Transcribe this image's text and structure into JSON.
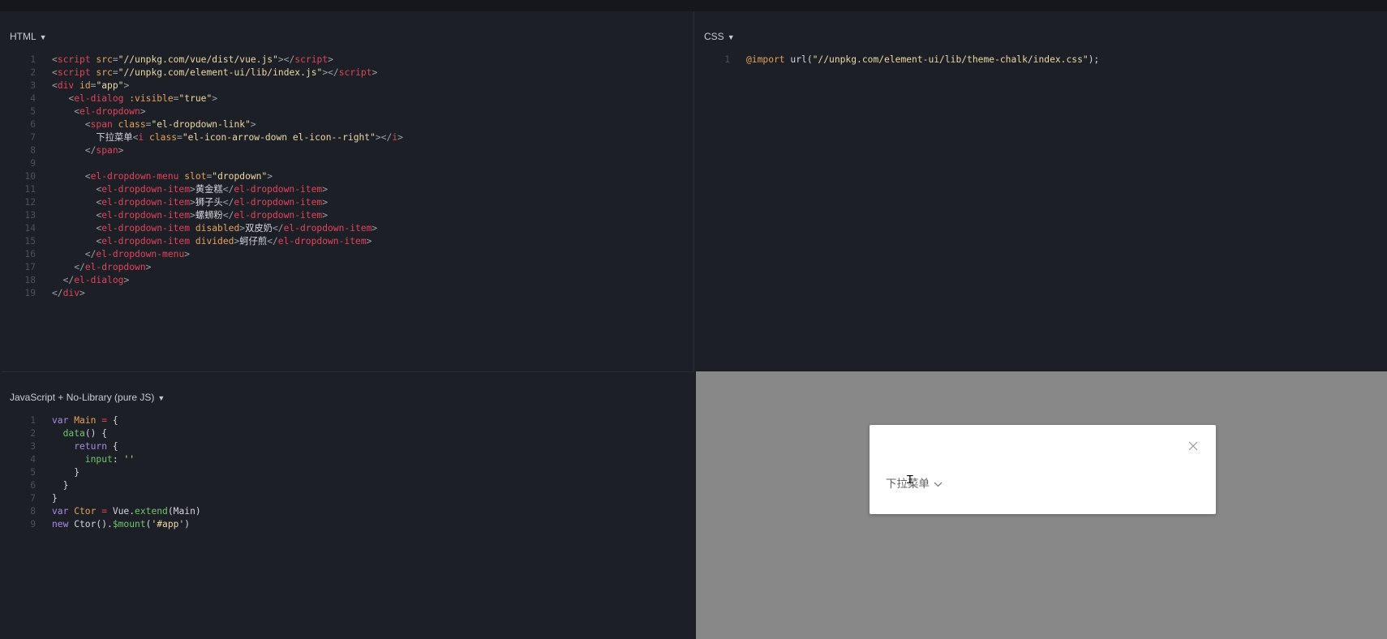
{
  "panels": {
    "html": {
      "title": "HTML"
    },
    "css": {
      "title": "CSS"
    },
    "js": {
      "title": "JavaScript + No-Library (pure JS)"
    }
  },
  "html_code": [
    [
      [
        "t-p",
        "<"
      ],
      [
        "t-tag",
        "script"
      ],
      [
        "t-attr",
        " src"
      ],
      [
        "t-p",
        "="
      ],
      [
        "t-str",
        "\"//unpkg.com/vue/dist/vue.js\""
      ],
      [
        "t-p",
        "></"
      ],
      [
        "t-tag",
        "script"
      ],
      [
        "t-p",
        ">"
      ]
    ],
    [
      [
        "t-p",
        "<"
      ],
      [
        "t-tag",
        "script"
      ],
      [
        "t-attr",
        " src"
      ],
      [
        "t-p",
        "="
      ],
      [
        "t-str",
        "\"//unpkg.com/element-ui/lib/index.js\""
      ],
      [
        "t-p",
        "></"
      ],
      [
        "t-tag",
        "script"
      ],
      [
        "t-p",
        ">"
      ]
    ],
    [
      [
        "t-p",
        "<"
      ],
      [
        "t-tag",
        "div"
      ],
      [
        "t-attr",
        " id"
      ],
      [
        "t-p",
        "="
      ],
      [
        "t-str",
        "\"app\""
      ],
      [
        "t-p",
        ">"
      ]
    ],
    [
      [
        "t-p",
        "   <"
      ],
      [
        "t-tag",
        "el-dialog"
      ],
      [
        "t-attr",
        " :visible"
      ],
      [
        "t-p",
        "="
      ],
      [
        "t-str",
        "\"true\""
      ],
      [
        "t-p",
        ">"
      ]
    ],
    [
      [
        "t-p",
        "    <"
      ],
      [
        "t-tag",
        "el-dropdown"
      ],
      [
        "t-p",
        ">"
      ]
    ],
    [
      [
        "t-p",
        "      <"
      ],
      [
        "t-tag",
        "span"
      ],
      [
        "t-attr",
        " class"
      ],
      [
        "t-p",
        "="
      ],
      [
        "t-str",
        "\"el-dropdown-link\""
      ],
      [
        "t-p",
        ">"
      ]
    ],
    [
      [
        "t-txt",
        "        下拉菜单"
      ],
      [
        "t-p",
        "<"
      ],
      [
        "t-tag",
        "i"
      ],
      [
        "t-attr",
        " class"
      ],
      [
        "t-p",
        "="
      ],
      [
        "t-str",
        "\"el-icon-arrow-down el-icon--right\""
      ],
      [
        "t-p",
        "></"
      ],
      [
        "t-tag",
        "i"
      ],
      [
        "t-p",
        ">"
      ]
    ],
    [
      [
        "t-p",
        "      </"
      ],
      [
        "t-tag",
        "span"
      ],
      [
        "t-p",
        ">"
      ]
    ],
    [],
    [
      [
        "t-p",
        "      <"
      ],
      [
        "t-tag",
        "el-dropdown-menu"
      ],
      [
        "t-attr",
        " slot"
      ],
      [
        "t-p",
        "="
      ],
      [
        "t-str",
        "\"dropdown\""
      ],
      [
        "t-p",
        ">"
      ]
    ],
    [
      [
        "t-p",
        "        <"
      ],
      [
        "t-tag",
        "el-dropdown-item"
      ],
      [
        "t-p",
        ">"
      ],
      [
        "t-txt",
        "黄金糕"
      ],
      [
        "t-p",
        "</"
      ],
      [
        "t-tag",
        "el-dropdown-item"
      ],
      [
        "t-p",
        ">"
      ]
    ],
    [
      [
        "t-p",
        "        <"
      ],
      [
        "t-tag",
        "el-dropdown-item"
      ],
      [
        "t-p",
        ">"
      ],
      [
        "t-txt",
        "狮子头"
      ],
      [
        "t-p",
        "</"
      ],
      [
        "t-tag",
        "el-dropdown-item"
      ],
      [
        "t-p",
        ">"
      ]
    ],
    [
      [
        "t-p",
        "        <"
      ],
      [
        "t-tag",
        "el-dropdown-item"
      ],
      [
        "t-p",
        ">"
      ],
      [
        "t-txt",
        "螺蛳粉"
      ],
      [
        "t-p",
        "</"
      ],
      [
        "t-tag",
        "el-dropdown-item"
      ],
      [
        "t-p",
        ">"
      ]
    ],
    [
      [
        "t-p",
        "        <"
      ],
      [
        "t-tag",
        "el-dropdown-item"
      ],
      [
        "t-attr",
        " disabled"
      ],
      [
        "t-p",
        ">"
      ],
      [
        "t-txt",
        "双皮奶"
      ],
      [
        "t-p",
        "</"
      ],
      [
        "t-tag",
        "el-dropdown-item"
      ],
      [
        "t-p",
        ">"
      ]
    ],
    [
      [
        "t-p",
        "        <"
      ],
      [
        "t-tag",
        "el-dropdown-item"
      ],
      [
        "t-attr",
        " divided"
      ],
      [
        "t-p",
        ">"
      ],
      [
        "t-txt",
        "蚵仔煎"
      ],
      [
        "t-p",
        "</"
      ],
      [
        "t-tag",
        "el-dropdown-item"
      ],
      [
        "t-p",
        ">"
      ]
    ],
    [
      [
        "t-p",
        "      </"
      ],
      [
        "t-tag",
        "el-dropdown-menu"
      ],
      [
        "t-p",
        ">"
      ]
    ],
    [
      [
        "t-p",
        "    </"
      ],
      [
        "t-tag",
        "el-dropdown"
      ],
      [
        "t-p",
        ">"
      ]
    ],
    [
      [
        "t-p",
        "  </"
      ],
      [
        "t-tag",
        "el-dialog"
      ],
      [
        "t-p",
        ">"
      ]
    ],
    [
      [
        "t-p",
        "</"
      ],
      [
        "t-tag",
        "div"
      ],
      [
        "t-p",
        ">"
      ]
    ]
  ],
  "css_code": [
    [
      [
        "t-attr",
        "@import"
      ],
      [
        "t-txt",
        " url("
      ],
      [
        "t-str",
        "\"//unpkg.com/element-ui/lib/theme-chalk/index.css\""
      ],
      [
        "t-txt",
        ");"
      ]
    ]
  ],
  "js_code": [
    [
      [
        "t-kw",
        "var"
      ],
      [
        "t-var",
        " Main"
      ],
      [
        "t-op",
        " ="
      ],
      [
        "t-txt",
        " {"
      ]
    ],
    [
      [
        "t-fn",
        "  data"
      ],
      [
        "t-txt",
        "() {"
      ]
    ],
    [
      [
        "t-kw",
        "    return"
      ],
      [
        "t-txt",
        " {"
      ]
    ],
    [
      [
        "t-fn",
        "      input"
      ],
      [
        "t-txt",
        ": "
      ],
      [
        "t-str",
        "''"
      ]
    ],
    [
      [
        "t-txt",
        "    }"
      ]
    ],
    [
      [
        "t-txt",
        "  }"
      ]
    ],
    [
      [
        "t-txt",
        "}"
      ]
    ],
    [
      [
        "t-kw",
        "var"
      ],
      [
        "t-var",
        " Ctor"
      ],
      [
        "t-op",
        " ="
      ],
      [
        "t-txt",
        " Vue."
      ],
      [
        "t-fn",
        "extend"
      ],
      [
        "t-txt",
        "(Main)"
      ]
    ],
    [
      [
        "t-kw",
        "new"
      ],
      [
        "t-txt",
        " Ctor()."
      ],
      [
        "t-fn",
        "$mount"
      ],
      [
        "t-txt",
        "("
      ],
      [
        "t-str",
        "'#app'"
      ],
      [
        "t-txt",
        ")"
      ]
    ]
  ],
  "output": {
    "dropdown_label": "下拉菜单"
  }
}
